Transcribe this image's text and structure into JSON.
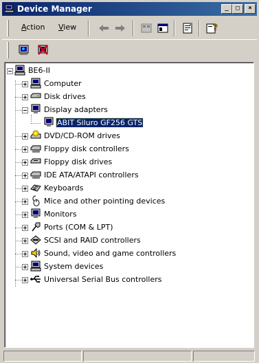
{
  "window": {
    "title": "Device Manager"
  },
  "titlebar_buttons": {
    "minimize": "_",
    "maximize": "□",
    "close": "×"
  },
  "menu": {
    "action": "Action",
    "view": "View"
  },
  "toolbar": {
    "items": [
      "back-arrow-icon",
      "forward-arrow-icon",
      "device-list-icon",
      "properties-pane-icon",
      "properties-icon",
      "help-icon"
    ]
  },
  "toolbar2": {
    "items": [
      "scan-hardware-icon",
      "uninstall-icon"
    ]
  },
  "tree": {
    "root": "BE6-II",
    "items": [
      {
        "label": "Computer",
        "expanded": false
      },
      {
        "label": "Disk drives",
        "expanded": false
      },
      {
        "label": "Display adapters",
        "expanded": true
      },
      {
        "label": "ABIT Siluro GF256 GTS",
        "child": true,
        "selected": true
      },
      {
        "label": "DVD/CD-ROM drives",
        "expanded": false
      },
      {
        "label": "Floppy disk controllers",
        "expanded": false
      },
      {
        "label": "Floppy disk drives",
        "expanded": false
      },
      {
        "label": "IDE ATA/ATAPI controllers",
        "expanded": false
      },
      {
        "label": "Keyboards",
        "expanded": false
      },
      {
        "label": "Mice and other pointing devices",
        "expanded": false
      },
      {
        "label": "Monitors",
        "expanded": false
      },
      {
        "label": "Ports (COM & LPT)",
        "expanded": false
      },
      {
        "label": "SCSI and RAID controllers",
        "expanded": false
      },
      {
        "label": "Sound, video and game controllers",
        "expanded": false
      },
      {
        "label": "System devices",
        "expanded": false
      },
      {
        "label": "Universal Serial Bus controllers",
        "expanded": false
      }
    ]
  },
  "colors": {
    "titlebar_start": "#0a246a",
    "titlebar_end": "#3a6ea5",
    "selection": "#0a246a",
    "face": "#d4d0c8"
  }
}
